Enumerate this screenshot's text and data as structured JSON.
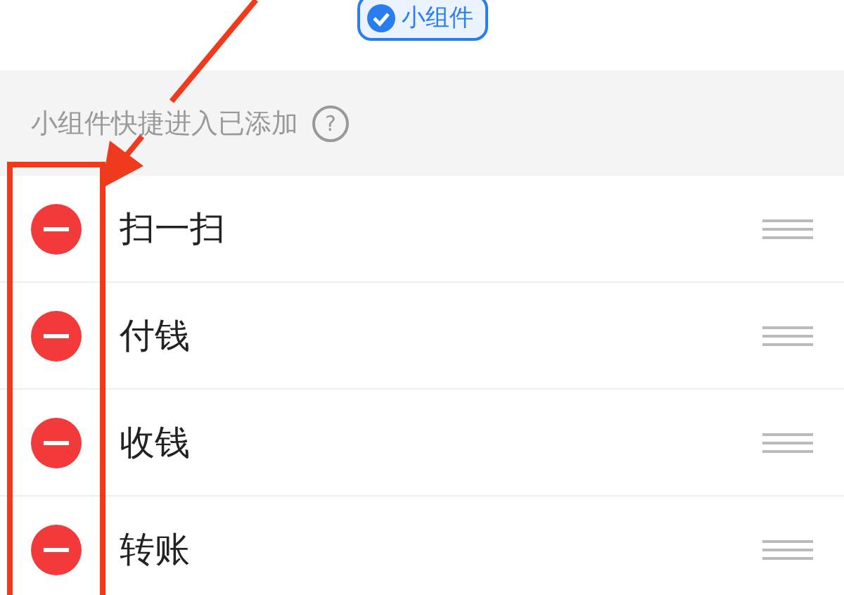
{
  "badge": {
    "label": "小组件",
    "checked": true
  },
  "section": {
    "title": "小组件快捷进入已添加",
    "help": "?"
  },
  "items": [
    {
      "label": "扫一扫"
    },
    {
      "label": "付钱"
    },
    {
      "label": "收钱"
    },
    {
      "label": "转账"
    }
  ]
}
